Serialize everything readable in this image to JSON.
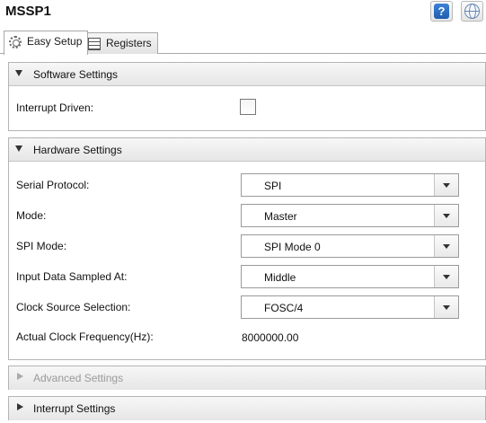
{
  "window": {
    "title": "MSSP1"
  },
  "toolbar": {
    "help_icon": "?",
    "web_icon": "globe-icon"
  },
  "tabs": [
    {
      "label": "Easy Setup",
      "icon": "gear-icon",
      "active": true
    },
    {
      "label": "Registers",
      "icon": "grid-icon",
      "active": false
    }
  ],
  "software": {
    "title": "Software Settings",
    "interrupt_driven": {
      "label": "Interrupt Driven:",
      "checked": false
    }
  },
  "hardware": {
    "title": "Hardware Settings",
    "serial_protocol": {
      "label": "Serial Protocol:",
      "value": "SPI"
    },
    "mode": {
      "label": "Mode:",
      "value": "Master"
    },
    "spi_mode": {
      "label": "SPI Mode:",
      "value": "SPI Mode 0"
    },
    "input_sampled": {
      "label": "Input Data Sampled At:",
      "value": "Middle"
    },
    "clock_source": {
      "label": "Clock Source Selection:",
      "value": "FOSC/4"
    },
    "actual_clock": {
      "label": "Actual Clock Frequency(Hz):",
      "value": "8000000.00"
    }
  },
  "advanced": {
    "title": "Advanced Settings",
    "enabled": false
  },
  "interrupt": {
    "title": "Interrupt Settings"
  }
}
